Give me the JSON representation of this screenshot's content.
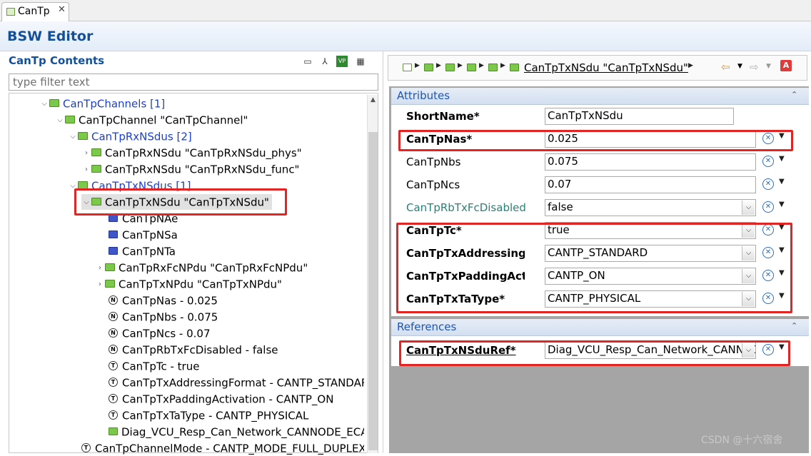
{
  "tab": {
    "label": "CanTp",
    "close": "✕"
  },
  "editor": {
    "title": "BSW Editor"
  },
  "left": {
    "title": "CanTp Contents",
    "filter_placeholder": "type filter text",
    "tools": [
      "▭",
      "⅄",
      "VP",
      "▦"
    ]
  },
  "tree": [
    {
      "label": "CanTpChannels [1]"
    },
    {
      "label": "CanTpChannel \"CanTpChannel\""
    },
    {
      "label": "CanTpRxNSdus [2]"
    },
    {
      "label": "CanTpRxNSdu \"CanTpRxNSdu_phys\""
    },
    {
      "label": "CanTpRxNSdu \"CanTpRxNSdu_func\""
    },
    {
      "label": "CanTpTxNSdus [1]"
    },
    {
      "label": "CanTpTxNSdu \"CanTpTxNSdu\""
    },
    {
      "label": "CanTpNAe"
    },
    {
      "label": "CanTpNSa"
    },
    {
      "label": "CanTpNTa"
    },
    {
      "label": "CanTpRxFcNPdu \"CanTpRxFcNPdu\""
    },
    {
      "label": "CanTpTxNPdu \"CanTpTxNPdu\""
    },
    {
      "label": "CanTpNas - 0.025"
    },
    {
      "label": "CanTpNbs - 0.075"
    },
    {
      "label": "CanTpNcs - 0.07"
    },
    {
      "label": "CanTpRbTxFcDisabled - false"
    },
    {
      "label": "CanTpTc - true"
    },
    {
      "label": "CanTpTxAddressingFormat - CANTP_STANDARD"
    },
    {
      "label": "CanTpTxPaddingActivation - CANTP_ON"
    },
    {
      "label": "CanTpTxTaType - CANTP_PHYSICAL"
    },
    {
      "label": "Diag_VCU_Resp_Can_Network_CANNODE_ECAN"
    },
    {
      "label": "CanTpChannelMode - CANTP_MODE_FULL_DUPLEX"
    }
  ],
  "breadcrumb": {
    "current": "CanTpTxNSdu \"CanTpTxNSdu\""
  },
  "attributes": {
    "title": "Attributes",
    "rows": [
      {
        "label": "ShortName*",
        "value": "CanTpTxNSdu"
      },
      {
        "label": "CanTpNas*",
        "value": "0.025"
      },
      {
        "label": "CanTpNbs",
        "value": "0.075"
      },
      {
        "label": "CanTpNcs",
        "value": "0.07"
      },
      {
        "label": "CanTpRbTxFcDisabled",
        "value": "false"
      },
      {
        "label": "CanTpTc*",
        "value": "true"
      },
      {
        "label": "CanTpTxAddressingFormat*",
        "value": "CANTP_STANDARD"
      },
      {
        "label": "CanTpTxPaddingActivation*",
        "value": "CANTP_ON"
      },
      {
        "label": "CanTpTxTaType*",
        "value": "CANTP_PHYSICAL"
      }
    ]
  },
  "references": {
    "title": "References",
    "rows": [
      {
        "label": "CanTpTxNSduRef*",
        "value": "Diag_VCU_Resp_Can_Network_CANNODE_ECAN"
      }
    ]
  },
  "watermark": "CSDN @十六宿舍",
  "colors": {
    "accent": "#14509a",
    "highlight": "#e32424",
    "link_blue": "#1a3fd2",
    "teal": "#2c8075"
  }
}
